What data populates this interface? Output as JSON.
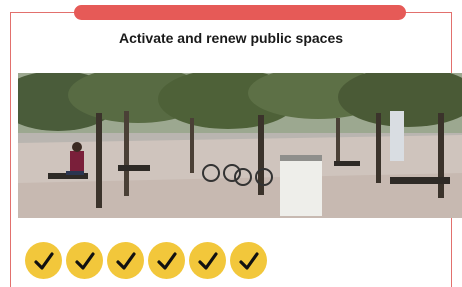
{
  "title": "Activate and renew public spaces",
  "photo_description_icon": "park-plaza-photo",
  "colors": {
    "accent": "#e65a57",
    "border": "#e2706d",
    "check": "#f2c73b"
  },
  "checks": {
    "count": 6,
    "icon": "checkmark-icon"
  }
}
